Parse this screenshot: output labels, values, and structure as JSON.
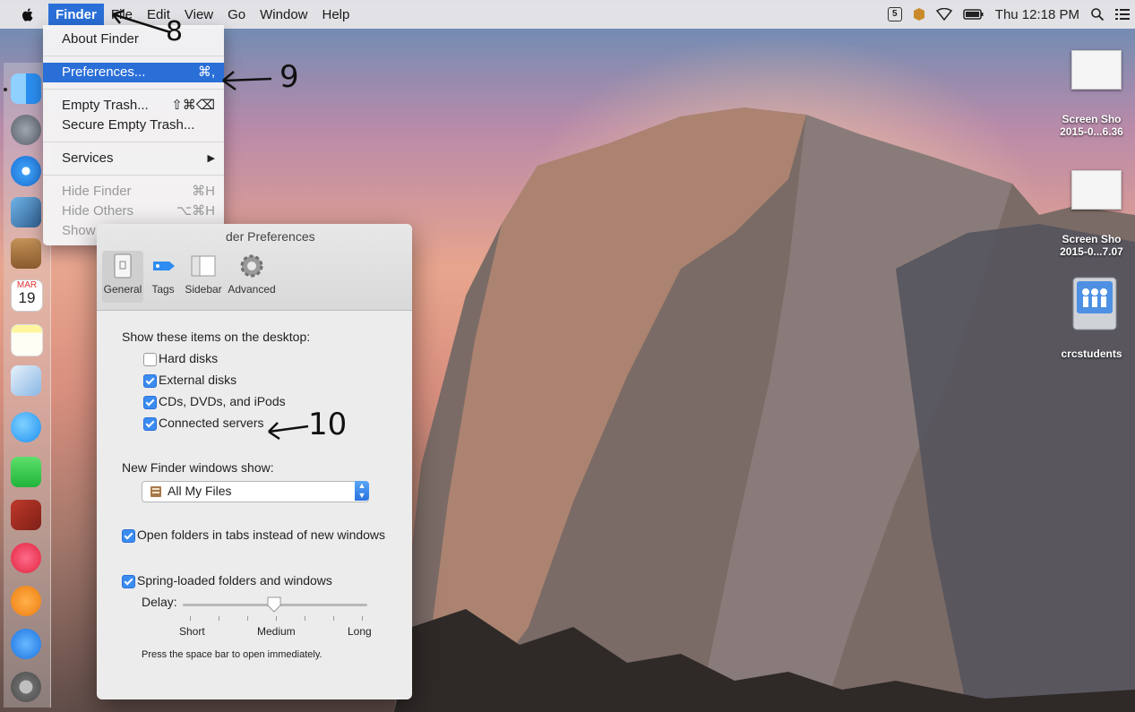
{
  "menubar": {
    "app_menu": "Finder",
    "items": [
      "File",
      "Edit",
      "View",
      "Go",
      "Window",
      "Help"
    ],
    "status": {
      "badge": "5",
      "clock": "Thu 12:18 PM"
    }
  },
  "finder_menu": {
    "about": "About Finder",
    "preferences": "Preferences...",
    "preferences_shortcut": "⌘,",
    "empty_trash": "Empty Trash...",
    "empty_trash_shortcut": "⇧⌘⌫",
    "secure_empty_trash": "Secure Empty Trash...",
    "services": "Services",
    "hide_finder": "Hide Finder",
    "hide_finder_shortcut": "⌘H",
    "hide_others": "Hide Others",
    "hide_others_shortcut": "⌥⌘H",
    "show_all": "Show All"
  },
  "prefs_window": {
    "title": "der Preferences",
    "tabs": [
      "General",
      "Tags",
      "Sidebar",
      "Advanced"
    ],
    "selected_tab": "General",
    "show_items_heading": "Show these items on the desktop:",
    "show_items": [
      {
        "label": "Hard disks",
        "checked": false
      },
      {
        "label": "External disks",
        "checked": true
      },
      {
        "label": "CDs, DVDs, and iPods",
        "checked": true
      },
      {
        "label": "Connected servers",
        "checked": true
      }
    ],
    "new_window_heading": "New Finder windows show:",
    "new_window_value": "All My Files",
    "open_in_tabs": "Open folders in tabs instead of new windows",
    "spring_loaded": "Spring-loaded folders and windows",
    "delay_label": "Delay:",
    "delay_marks": [
      "Short",
      "Medium",
      "Long"
    ],
    "delay_value": "Medium",
    "hint": "Press the space bar to open immediately."
  },
  "dock": {
    "calendar_month": "MAR",
    "calendar_day": "19"
  },
  "desktop_icons": [
    {
      "line1": "Screen Sho",
      "line2": "2015-0...6.36"
    },
    {
      "line1": "Screen Sho",
      "line2": "2015-0...7.07"
    },
    {
      "line1": "crcstudents",
      "line2": ""
    }
  ],
  "annotations": [
    "8",
    "9",
    "10"
  ]
}
